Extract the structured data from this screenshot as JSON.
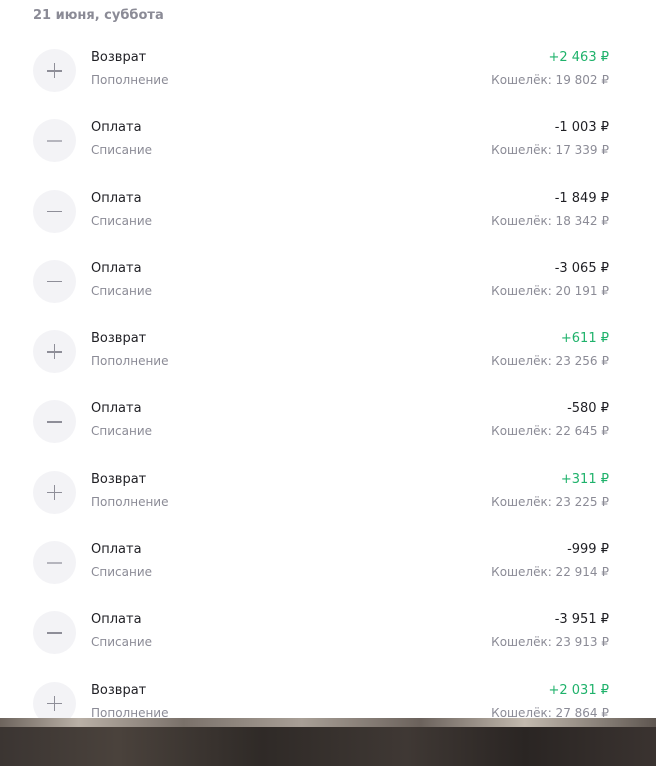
{
  "date_header": "21 июня, суббота",
  "transactions": [
    {
      "title": "Возврат",
      "subtitle": "Пополнение",
      "amount": "+2 463 ₽",
      "balance": "Кошелёк: 19 802 ₽",
      "kind": "plus"
    },
    {
      "title": "Оплата",
      "subtitle": "Списание",
      "amount": "-1 003 ₽",
      "balance": "Кошелёк: 17 339 ₽",
      "kind": "minus"
    },
    {
      "title": "Оплата",
      "subtitle": "Списание",
      "amount": "-1 849 ₽",
      "balance": "Кошелёк: 18 342 ₽",
      "kind": "minus"
    },
    {
      "title": "Оплата",
      "subtitle": "Списание",
      "amount": "-3 065 ₽",
      "balance": "Кошелёк: 20 191 ₽",
      "kind": "minus"
    },
    {
      "title": "Возврат",
      "subtitle": "Пополнение",
      "amount": "+611 ₽",
      "balance": "Кошелёк: 23 256 ₽",
      "kind": "plus"
    },
    {
      "title": "Оплата",
      "subtitle": "Списание",
      "amount": "-580 ₽",
      "balance": "Кошелёк: 22 645 ₽",
      "kind": "minus"
    },
    {
      "title": "Возврат",
      "subtitle": "Пополнение",
      "amount": "+311 ₽",
      "balance": "Кошелёк: 23 225 ₽",
      "kind": "plus"
    },
    {
      "title": "Оплата",
      "subtitle": "Списание",
      "amount": "-999 ₽",
      "balance": "Кошелёк: 22 914 ₽",
      "kind": "minus"
    },
    {
      "title": "Оплата",
      "subtitle": "Списание",
      "amount": "-3 951 ₽",
      "balance": "Кошелёк: 23 913 ₽",
      "kind": "minus"
    },
    {
      "title": "Возврат",
      "subtitle": "Пополнение",
      "amount": "+2 031 ₽",
      "balance": "Кошелёк: 27 864 ₽",
      "kind": "plus"
    }
  ],
  "icons": {
    "plus": "plus-icon",
    "minus": "minus-icon"
  },
  "colors": {
    "positive_amount": "#1fb26b",
    "text": "#1f1f24",
    "muted_text": "#8b8b96",
    "icon_bg": "#f3f3f6"
  }
}
